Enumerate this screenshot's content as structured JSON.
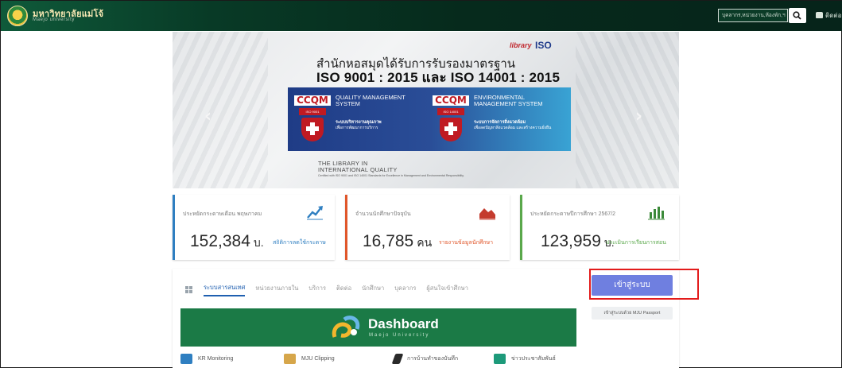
{
  "header": {
    "university_name": "มหาวิทยาลัยแม่โจ้",
    "university_sub": "Maejo university",
    "search_placeholder": "บุคลากร,หน่วยงาน,ห้องพัก,ฯ",
    "contact_label": "ติดต่อ"
  },
  "banner": {
    "tag_library": "library",
    "tag_iso": "ISO",
    "line1": "สำนักหอสมุดได้รับการรับรองมาตรฐาน",
    "line2": "ISO 9001 : 2015 และ ISO 14001 : 2015",
    "cert1": {
      "mark": "CCQM",
      "badge": "ISO 9001 CERTIFIED",
      "title": "QUALITY MANAGEMENT SYSTEM",
      "desc_bold": "ระบบบริหารงานคุณภาพ",
      "desc": "เพื่อการพัฒนาการบริการ"
    },
    "cert2": {
      "mark": "CCQM",
      "badge": "ISO 14001 CERTIFIED",
      "title": "ENVIRONMENTAL MANAGEMENT SYSTEM",
      "desc_bold": "ระบบการจัดการสิ่งแวดล้อม",
      "desc": "เพื่อลดปัญหาสิ่งแวดล้อม และสร้างความยั่งยืน"
    },
    "library_line1": "THE LIBRARY IN",
    "library_line2": "INTERNATIONAL QUALITY",
    "footnote": "Certified with ISO 9001 and ISO 14001 Standards for Excellence in Management and Environmental Responsibility.",
    "prev": "‹",
    "next": "›"
  },
  "stats": [
    {
      "label": "ประหยัดกระดาษเดือน พฤษภาคม",
      "value": "152,384",
      "unit": "บ.",
      "link": "สถิติการลดใช้กระดาษ",
      "color": "#2f7fc1"
    },
    {
      "label": "จำนวนนักศึกษาปัจจุบัน",
      "value": "16,785",
      "unit": "คน",
      "link": "รายงานข้อมูลนักศึกษา",
      "color": "#e0562a"
    },
    {
      "label": "ประหยัดกระดาษปีการศึกษา 2567/2",
      "value": "123,959",
      "unit": "บ.",
      "link": "ประเมินการเรียนการสอน",
      "color": "#5aa84b"
    }
  ],
  "tabs": [
    "ระบบสารสนเทศ",
    "หน่วยงานภายใน",
    "บริการ",
    "ติดต่อ",
    "นักศึกษา",
    "บุคลากร",
    "ผู้สนใจเข้าศึกษา"
  ],
  "login": {
    "button": "เข้าสู่ระบบ",
    "passport": "เข้าสู่ระบบด้วย MJU Passport"
  },
  "dashboard": {
    "title": "Dashboard",
    "subtitle": "Maejo University"
  },
  "quick_links": [
    {
      "label": "KR Monitoring",
      "icon": "monitor-icon",
      "color": "#2f7fc1"
    },
    {
      "label": "MJU Clipping",
      "icon": "newspaper-icon",
      "color": "#d6a64a"
    },
    {
      "label": "การบ้านทำของบันทึก",
      "icon": "pen-icon",
      "color": "#2a2a2a"
    },
    {
      "label": "ข่าวประชาสัมพันธ์",
      "icon": "megaphone-icon",
      "color": "#1d9a7a"
    }
  ]
}
